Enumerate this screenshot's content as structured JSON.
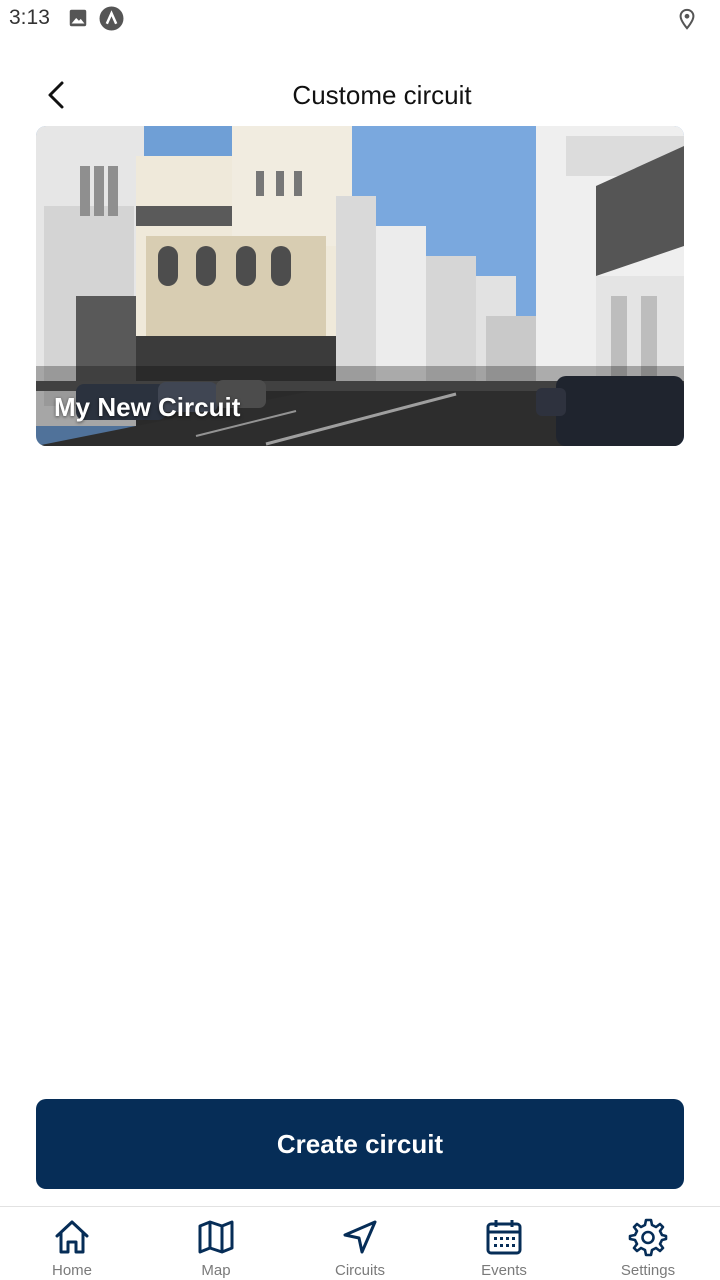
{
  "status_bar": {
    "time": "3:13",
    "icons": [
      "image-icon",
      "app-a-icon",
      "location-pin-icon"
    ]
  },
  "header": {
    "title": "Custome circuit",
    "back_icon": "chevron-left-icon"
  },
  "circuits": [
    {
      "title": "My New Circuit",
      "image": "city street with white colonial buildings"
    }
  ],
  "create_button": {
    "label": "Create circuit"
  },
  "colors": {
    "primary": "#062d57",
    "nav_label": "#7a7a7a"
  },
  "bottom_nav": {
    "items": [
      {
        "label": "Home",
        "icon": "home-icon"
      },
      {
        "label": "Map",
        "icon": "map-icon"
      },
      {
        "label": "Circuits",
        "icon": "navigation-arrow-icon"
      },
      {
        "label": "Events",
        "icon": "calendar-icon"
      },
      {
        "label": "Settings",
        "icon": "gear-icon"
      }
    ]
  }
}
